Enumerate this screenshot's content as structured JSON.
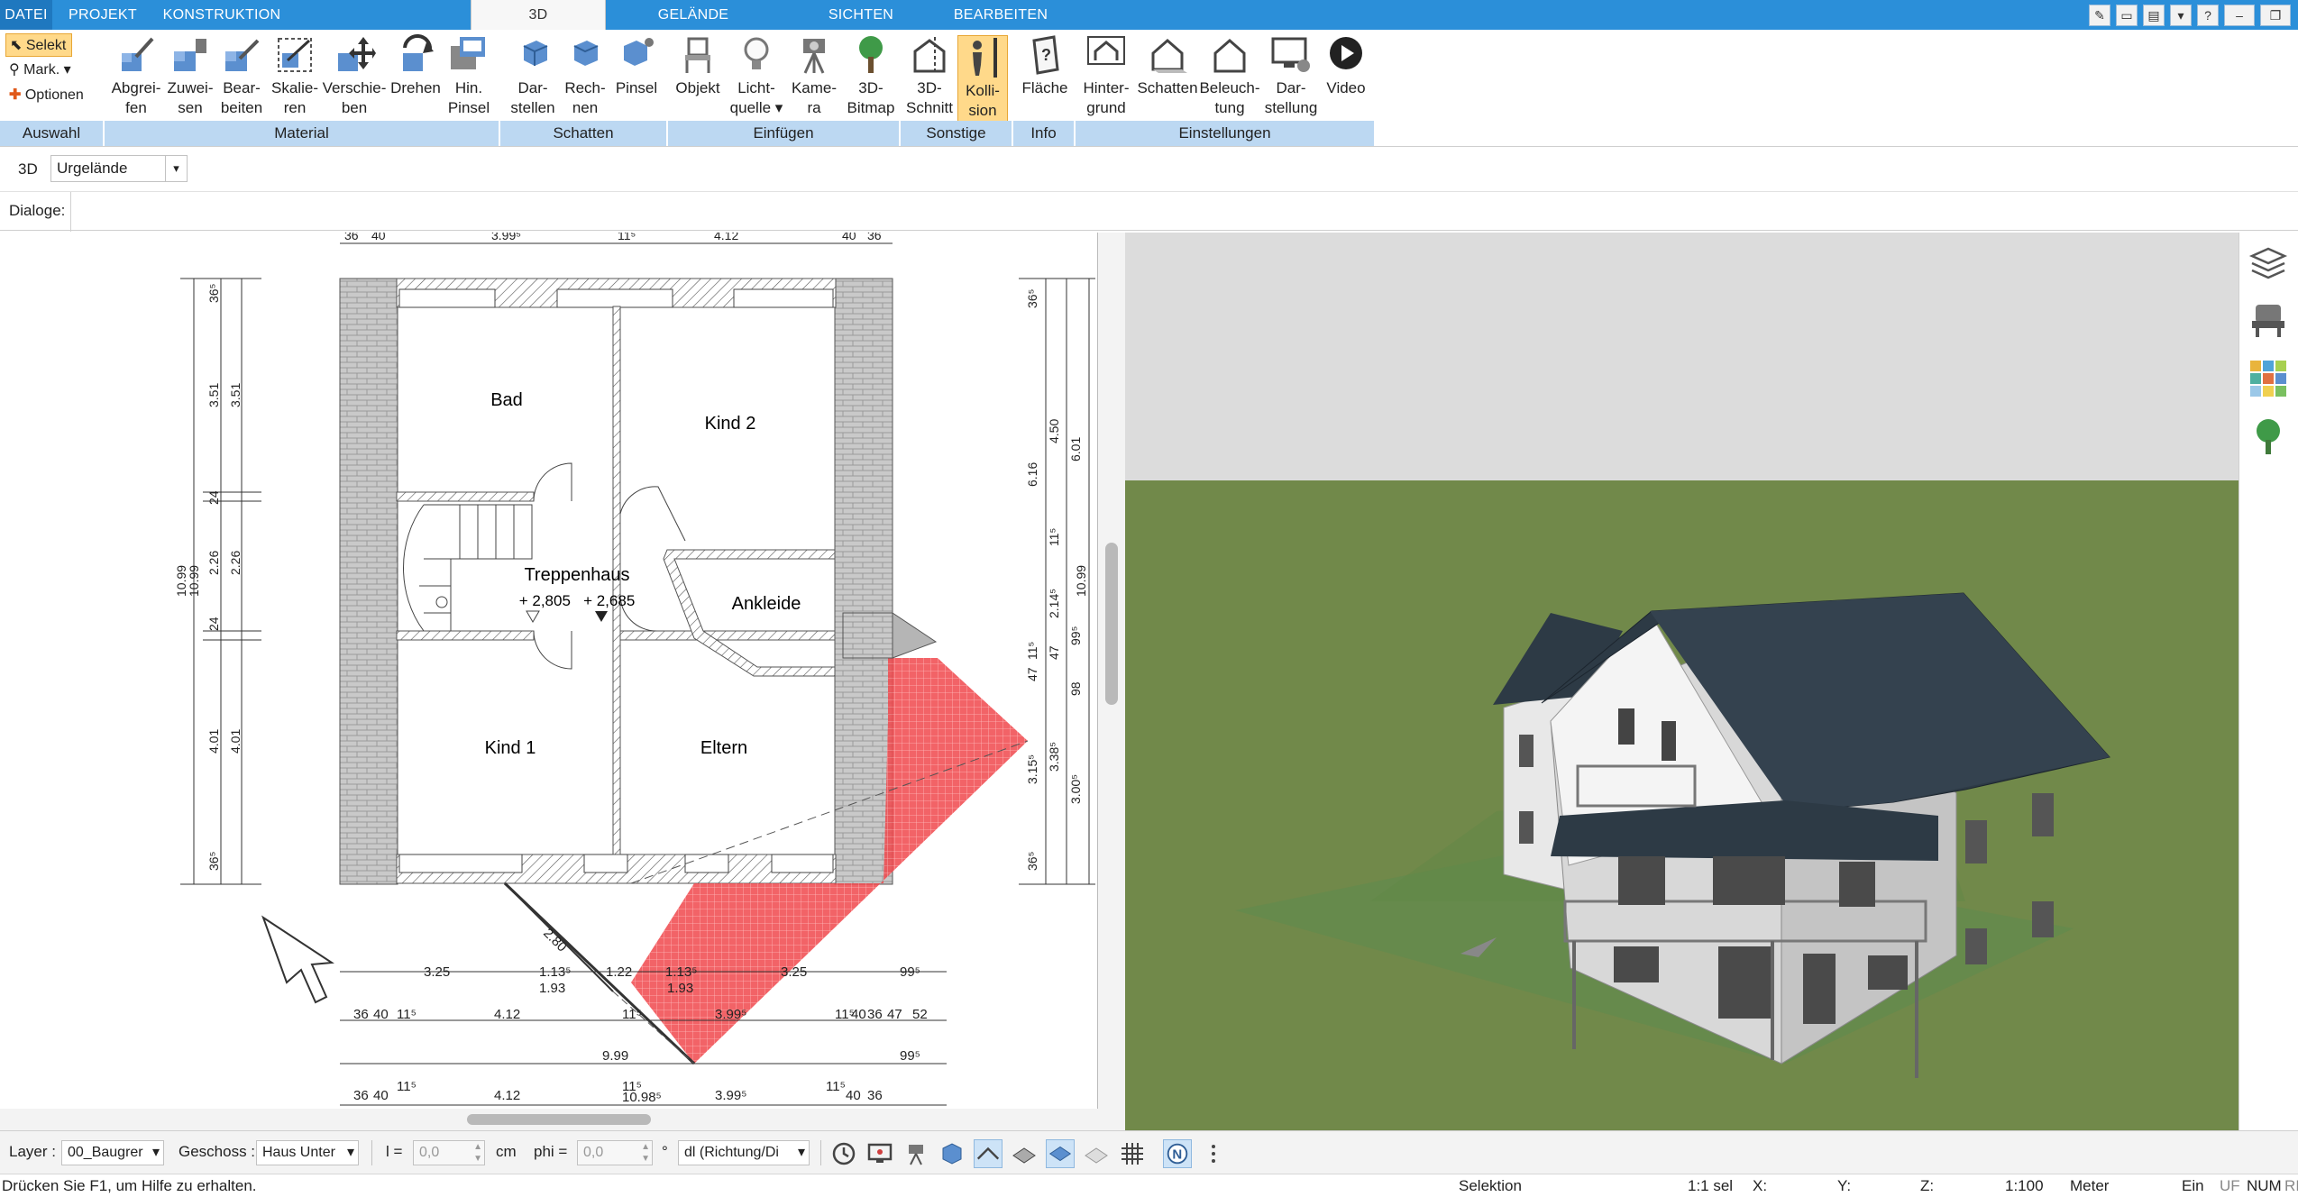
{
  "menubar": {
    "file_tab": "DATEI",
    "tabs": [
      "PROJEKT",
      "KONSTRUKTION",
      "3D",
      "GELÄNDE",
      "SICHTEN",
      "BEARBEITEN"
    ],
    "active_tab": "3D"
  },
  "ribbon": {
    "auswahl": {
      "select": "Selekt",
      "mark": "Mark.",
      "options": "Optionen",
      "group": "Auswahl"
    },
    "material": {
      "group": "Material",
      "buttons": [
        {
          "l1": "Abgrei-",
          "l2": "fen"
        },
        {
          "l1": "Zuwei-",
          "l2": "sen"
        },
        {
          "l1": "Bear-",
          "l2": "beiten"
        },
        {
          "l1": "Skalie-",
          "l2": "ren"
        },
        {
          "l1": "Verschie-",
          "l2": "ben"
        },
        {
          "l1": "Drehen",
          "l2": ""
        },
        {
          "l1": "Hin.",
          "l2": "Pinsel"
        }
      ]
    },
    "schatten": {
      "group": "Schatten",
      "buttons": [
        {
          "l1": "Dar-",
          "l2": "stellen"
        },
        {
          "l1": "Rech-",
          "l2": "nen"
        },
        {
          "l1": "Pinsel",
          "l2": ""
        }
      ]
    },
    "einfuegen": {
      "group": "Einfügen",
      "buttons": [
        {
          "l1": "Objekt",
          "l2": ""
        },
        {
          "l1": "Licht-",
          "l2": "quelle"
        },
        {
          "l1": "Kame-",
          "l2": "ra"
        },
        {
          "l1": "3D-",
          "l2": "Bitmap"
        }
      ]
    },
    "sonstige": {
      "group": "Sonstige",
      "buttons": [
        {
          "l1": "3D-",
          "l2": "Schnitt"
        },
        {
          "l1": "Kolli-",
          "l2": "sion"
        }
      ]
    },
    "info": {
      "group": "Info",
      "buttons": [
        {
          "l1": "Fläche",
          "l2": ""
        }
      ]
    },
    "einstellungen": {
      "group": "Einstellungen",
      "buttons": [
        {
          "l1": "Hinter-",
          "l2": "grund"
        },
        {
          "l1": "Schatten",
          "l2": ""
        },
        {
          "l1": "Beleuch-",
          "l2": "tung"
        },
        {
          "l1": "Dar-",
          "l2": "stellung"
        },
        {
          "l1": "Video",
          "l2": ""
        }
      ]
    }
  },
  "options": {
    "mode": "3D",
    "terrain": "Urgelände",
    "dialogs_label": "Dialoge:"
  },
  "plan": {
    "rooms": [
      "Bad",
      "Kind 2",
      "Treppenhaus",
      "Ankleide",
      "Kind 1",
      "Eltern"
    ],
    "levels": "+ 2,805   + 2,685",
    "top_dims": [
      "36",
      "40",
      "3.99⁵",
      "11⁵",
      "4.12",
      "40",
      "36"
    ],
    "left_dims": [
      "36⁵",
      "3.51",
      "3.51",
      "24",
      "2.26",
      "2.26",
      "24",
      "4.01",
      "4.01",
      "36⁵",
      "10.99",
      "10.99"
    ],
    "right_dims": [
      "36⁵",
      "4.50",
      "6.01",
      "6.16",
      "11⁵",
      "10.99",
      "2.14⁵",
      "99⁵",
      "47",
      "47",
      "11⁵",
      "98",
      "3.15⁵",
      "3.38⁵",
      "3.00⁵",
      "36⁵"
    ],
    "bottom_row1": [
      "3.25",
      "1.13⁵",
      "1.22",
      "1.13⁵",
      "3.25",
      "99⁵"
    ],
    "bottom_row1b": [
      "1.93",
      "1.93"
    ],
    "bottom_row2": [
      "36",
      "40",
      "11⁵",
      "4.12",
      "11⁵",
      "3.99⁵",
      "11⁵",
      "40",
      "36",
      "47",
      "52"
    ],
    "bottom_row3": [
      "9.99",
      "99⁵"
    ],
    "bottom_row4": [
      "36",
      "40",
      "11⁵",
      "4.12",
      "10.98⁵",
      "11⁵",
      "3.99⁵",
      "11⁵",
      "40",
      "36"
    ],
    "diag_dim": "2.80"
  },
  "bottombar": {
    "layer_label": "Layer :",
    "layer_value": "00_Baugrer",
    "floor_label": "Geschoss :",
    "floor_value": "Haus Unter",
    "l_label": "l =",
    "l_value": "0,0",
    "l_unit": "cm",
    "phi_label": "phi =",
    "phi_value": "0,0",
    "phi_unit": "°",
    "dir_value": "dl (Richtung/Di"
  },
  "statusbar": {
    "help": "Drücken Sie F1, um Hilfe zu erhalten.",
    "mode": "Selektion",
    "sel": "1:1 sel",
    "x": "X:",
    "y": "Y:",
    "z": "Z:",
    "scale": "1:100",
    "unit": "Meter",
    "ein": "Ein",
    "uf": "UF",
    "num": "NUM",
    "ri": "RI"
  },
  "colors": {
    "accent": "#2b8fd9",
    "active": "#ffd98a",
    "group": "#bcd8f2",
    "grass": "#6f8a43",
    "roof": "#2d3a45"
  }
}
